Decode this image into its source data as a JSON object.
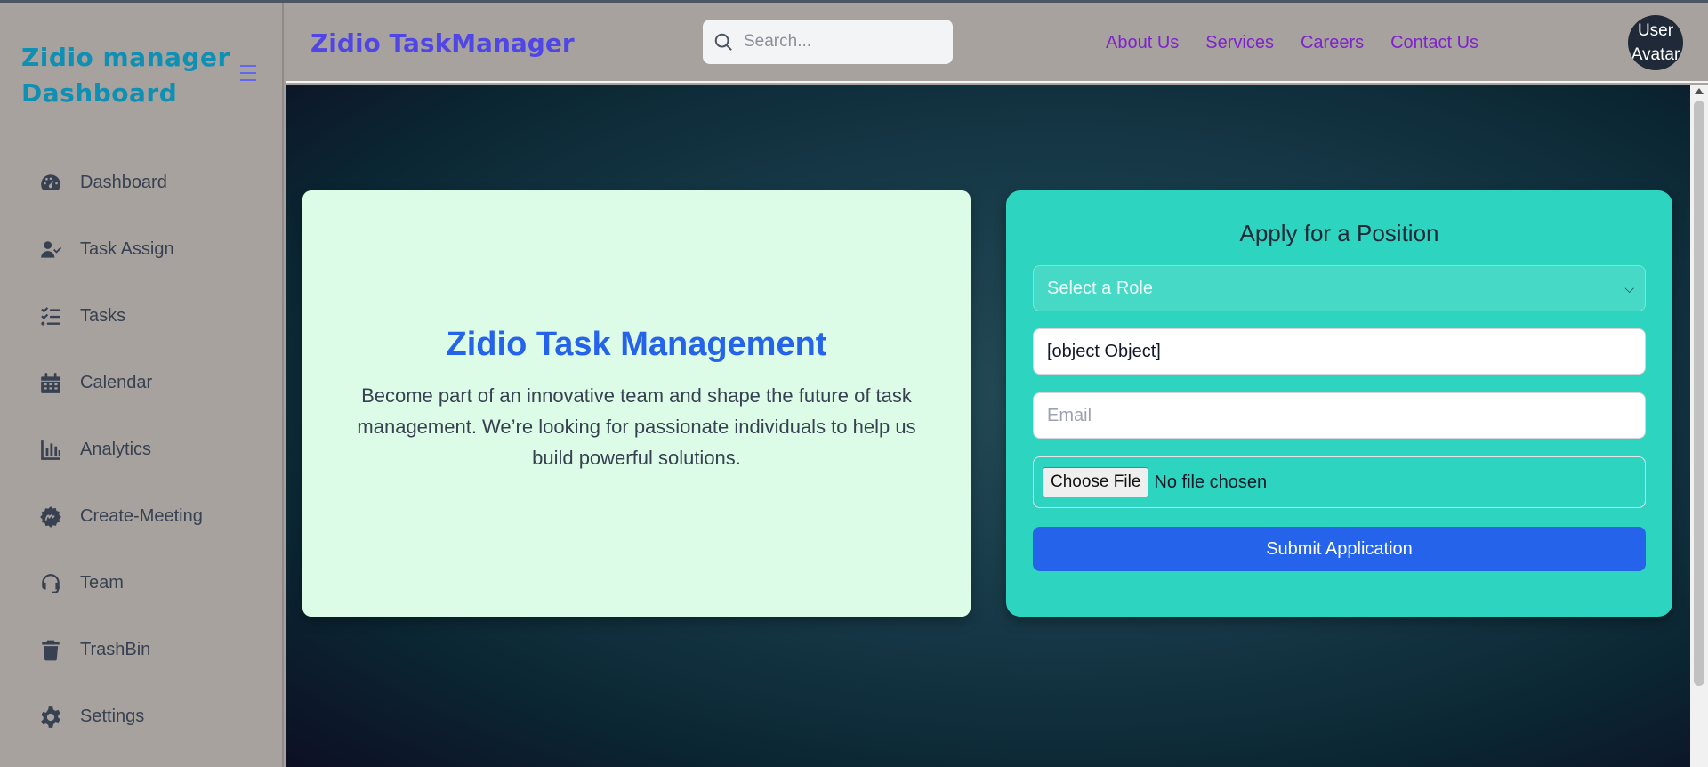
{
  "sidebar": {
    "brand": "Zidio manager Dashboard",
    "menu_icon": "hamburger-icon",
    "items": [
      {
        "label": "Dashboard",
        "icon": "gauge-icon"
      },
      {
        "label": "Task Assign",
        "icon": "user-check-icon"
      },
      {
        "label": "Tasks",
        "icon": "list-check-icon"
      },
      {
        "label": "Calendar",
        "icon": "calendar-icon"
      },
      {
        "label": "Analytics",
        "icon": "bar-chart-icon"
      },
      {
        "label": "Create-Meeting",
        "icon": "meeting-icon"
      },
      {
        "label": "Team",
        "icon": "headset-icon"
      },
      {
        "label": "TrashBin",
        "icon": "trash-icon"
      },
      {
        "label": "Settings",
        "icon": "gear-icon"
      }
    ]
  },
  "header": {
    "title": "Zidio TaskManager",
    "search_placeholder": "Search...",
    "links": [
      "About Us",
      "Services",
      "Careers",
      "Contact Us"
    ],
    "avatar_alt": "User Avatar"
  },
  "hero": {
    "title": "Zidio Task Management",
    "description": "Become part of an innovative team and shape the future of task management. We’re looking for passionate individuals to help us build powerful solutions."
  },
  "application_form": {
    "title": "Apply for a Position",
    "role_select": "Select a Role",
    "name_value": "[object Object]",
    "email_placeholder": "Email",
    "file_button": "Choose File",
    "file_status": "No file chosen",
    "submit_label": "Submit Application"
  },
  "colors": {
    "brand": "#0e8fb4",
    "header_title": "#4f46e5",
    "links": "#7e22ce",
    "hero_title": "#2563eb",
    "form_bg": "#2dd4bf",
    "hero_bg": "#dcfce7",
    "submit": "#2563eb"
  }
}
